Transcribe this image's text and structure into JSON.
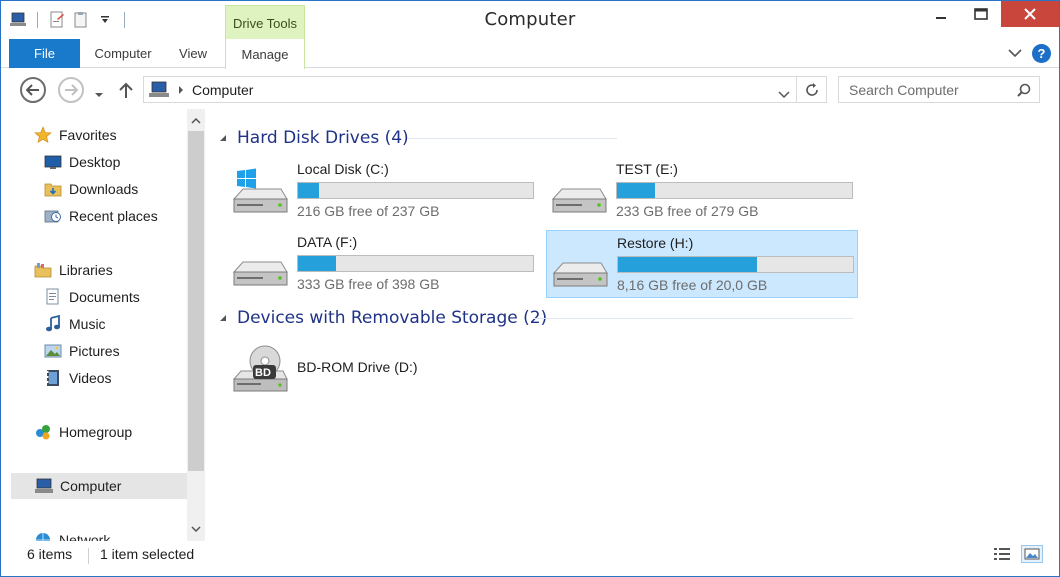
{
  "window": {
    "title": "Computer",
    "contextual_tab": "Drive Tools"
  },
  "ribbon": {
    "tabs": [
      "File",
      "Computer",
      "View",
      "Manage"
    ]
  },
  "address": {
    "path": "Computer",
    "search_placeholder": "Search Computer"
  },
  "nav": {
    "favorites": "Favorites",
    "desktop": "Desktop",
    "downloads": "Downloads",
    "recent": "Recent places",
    "libraries": "Libraries",
    "documents": "Documents",
    "music": "Music",
    "pictures": "Pictures",
    "videos": "Videos",
    "homegroup": "Homegroup",
    "computer": "Computer",
    "network": "Network"
  },
  "groups": {
    "hdd": {
      "title": "Hard Disk Drives (4)"
    },
    "removable": {
      "title": "Devices with Removable Storage (2)"
    }
  },
  "drives": [
    {
      "name": "Local Disk (C:)",
      "free_text": "216 GB free of 237 GB",
      "used_fraction": 0.09,
      "selected": false
    },
    {
      "name": "TEST (E:)",
      "free_text": "233 GB free of 279 GB",
      "used_fraction": 0.16,
      "selected": false
    },
    {
      "name": "DATA (F:)",
      "free_text": "333 GB free of 398 GB",
      "used_fraction": 0.16,
      "selected": false
    },
    {
      "name": "Restore (H:)",
      "free_text": "8,16 GB free of 20,0 GB",
      "used_fraction": 0.59,
      "selected": true
    }
  ],
  "removable": [
    {
      "name": "BD-ROM Drive (D:)",
      "badge": "BD"
    }
  ],
  "status": {
    "items": "6 items",
    "selected": "1 item selected"
  },
  "colors": {
    "accent": "#1979ca",
    "bar_fill": "#26a0da",
    "group_header": "#1e3287",
    "selection": "#cce8ff",
    "close_button": "#c9463d",
    "contextual_tab": "#dff3c0"
  },
  "icons": {
    "qat": [
      "computer-icon",
      "properties-icon",
      "new-folder-icon",
      "customize-qat-icon"
    ],
    "nav_buttons": [
      "back-arrow-icon",
      "forward-arrow-icon",
      "recent-locations-icon",
      "up-arrow-icon"
    ]
  }
}
